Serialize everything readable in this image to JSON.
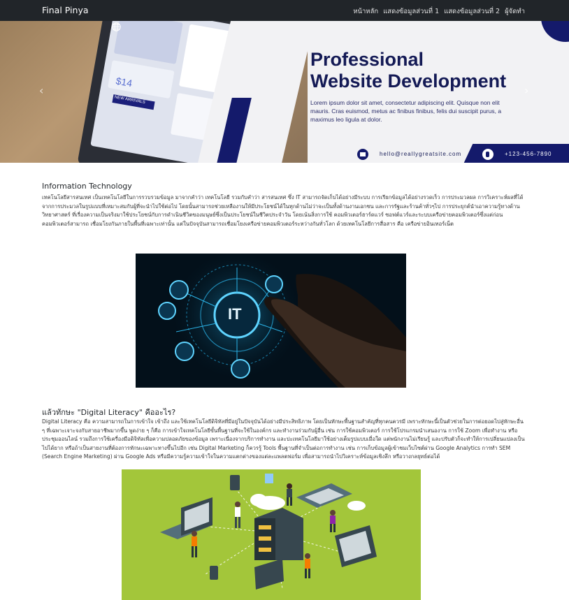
{
  "navbar": {
    "brand": "Final Pinya",
    "links": [
      "หน้าหลัก",
      "แสดงข้อมูลส่วนที่ 1",
      "แสดงข้อมูลส่วนที่ 2",
      "ผู้จัดทำ"
    ]
  },
  "hero": {
    "title_line1": "Professional",
    "title_line2": "Website Development",
    "lorem": "Lorem ipsum dolor sit amet, consectetur adipiscing elit. Quisque non elit mauris. Cras euismod, metus ac finibus finibus, felis dui suscipit purus, a maximus leo ligula at dolor.",
    "email": "hello@reallygreatsite.com",
    "phone": "+123-456-7890",
    "laptop_badge": "NEW ARRIVALS",
    "laptop_number": "$14"
  },
  "section1": {
    "title": "Information Technology",
    "text": "เทคโนโลยีสารสนเทศ เป็นเทคโนโลยีในการรวบรวมข้อมูล มาจากคำว่า เทคโนโลยี รวมกับคำว่า สารสนเทศ ซึ่ง IT สามารถจัดเก็บได้อย่างมีระบบ การเรียกข้อมูลได้อย่างรวดเร็ว การประมวลผล การวิเคราะห์ผลที่ได้จากการประมวลในรูปแบบที่เหมาะสมกับผู้ที่จะนำไปใช้ต่อไป โดยนั้นสามารถช่วยเหลืองานให้มีประโยชน์ได้ในทุกด้านไม่ว่าจะเป็นทั้งด้านงานเอกชน และการรัฐและร้านค้าทั่วๆไป การประยุกต์นำเอาความรู้ทางด้านวิทยาศาสตร์ ที่เรื่องความเป็นจริงมาใช้ประโยชน์กับการดำเนินชีวิตของมนุษย์ซึ่งเป็นประโยชน์ในชีวิตประจำวัน โดยเน้นสิ่งการใช้ คอมพิวเตอร์ฮาร์ดแวร์ ซอฟต์แวร์และระบบเครือข่ายคอมพิวเตอร์ซึ่งแต่ก่อนคอมพิวเตอร์สามารถ เชื่อมโยงกันภายในพื้นที่เฉพาะเท่านั้น แต่ในปัจจุบันสามารถเชื่อมโยงเครือข่ายคอมพิวเตอร์ระหว่างกันทั่วโลก ด้วยเทคโนโลยีการสื่อสาร คือ เครือข่ายอินเทอร์เน็ต"
  },
  "it_image": {
    "label": "IT"
  },
  "section2": {
    "title": "แล้วทักษะ \"Digital Literacy\" คืออะไร?",
    "text": "Digital Literacy คือ ความสามารถในการเข้าใจ เข้าถึง และใช้เทคโนโลยีดิจิทัลที่มีอยู่ในปัจจุบันได้อย่างมีประสิทธิภาพ โดยเป็นทักษะพื้นฐานสำคัญที่ทุกคนควรมี เพราะทักษะนี้เป็นตัวช่วยในการต่อยอดไปสู่ทักษะอื่น ๆ ที่เฉพาะเจาะจงกับสายอาชีพมากขึ้น พูดง่าย ๆ ก็คือ การเข้าใจเทคโนโลยีขั้นพื้นฐานที่จะใช้ในองค์กร และทำงานร่วมกับผู้อื่น เช่น การใช้คอมพิวเตอร์ การใช้โปรแกรมนำเสนองาน การใช้ Zoom เพื่อทำงาน หรือประชุมออนไลน์ รวมถึงการใช้เครื่องมือดิจิทัลเพื่อความปลอดภัยของข้อมูล เพราะเนื่องจากบริการทำงาน และปะเทคโนโลยีมาใช้อย่างเต็มรูปแบบเมื่อใด แต่พนักงานไม่เรียนรู้ และปรับตัวก็จะทำให้การเปลี่ยนแปลงเป็นไปได้ยาก หรือถ้าเป็นสายงานที่ต้องการทักษะเฉพาะทางขึ้นไปอีก เช่น Digital Marketing ก็ควรรู้ Tools พื้นฐานที่จำเป็นต่อการทำงาน เช่น การเก็บข้อมูลผู้เข้าชมเว็บไซต์ผ่าน Google Analytics การทำ SEM (Search Engine Marketing) ผ่าน Google Ads หรือมีความรู้ความเข้าใจในความแตกต่างของแต่ละแพลตฟอร์ม เพื่อสามารถนำไปวิเคราะห์ข้อมูลเชิงลึก หรือวางกลยุทธ์ต่อได้"
  },
  "colors": {
    "navbar": "#212529",
    "navy": "#141a6b",
    "lime": "#a3c63a"
  }
}
